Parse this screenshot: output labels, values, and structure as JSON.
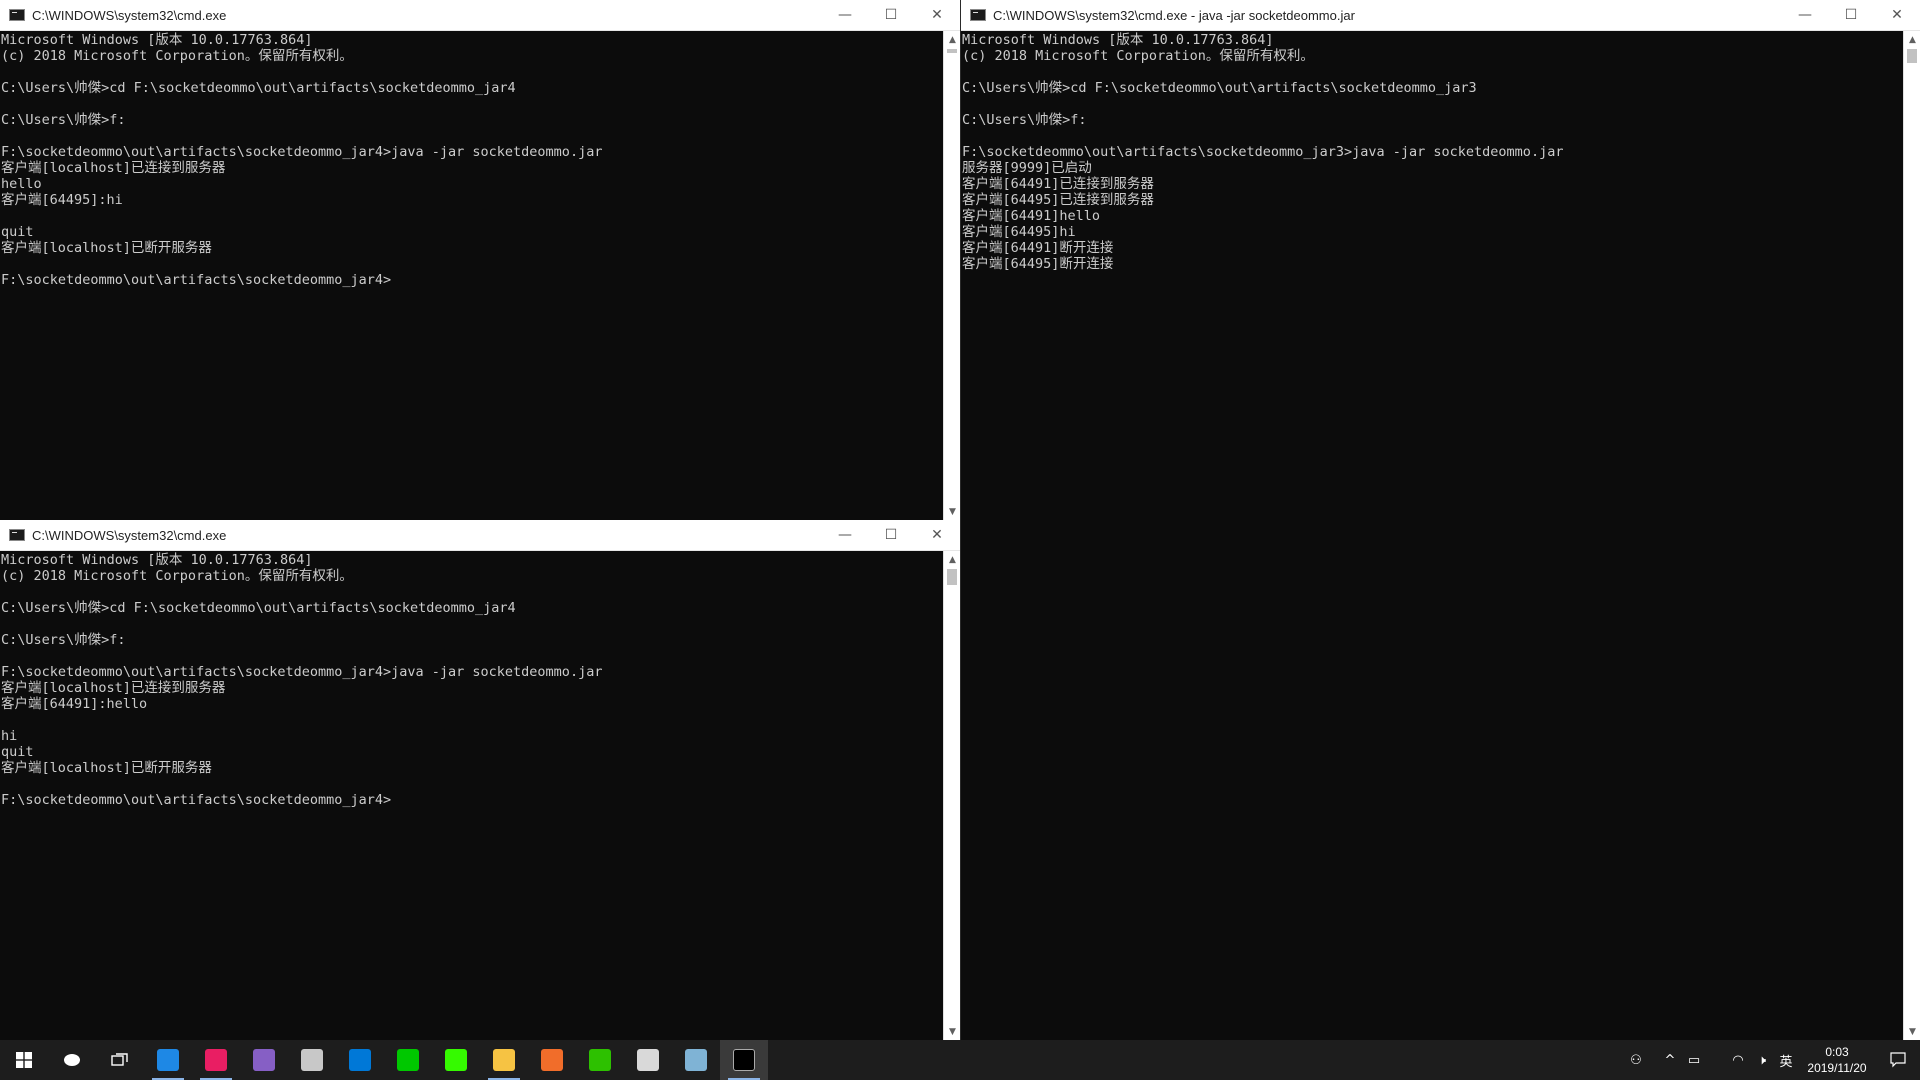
{
  "windows": {
    "top_left": {
      "title": "C:\\WINDOWS\\system32\\cmd.exe",
      "lines": [
        "Microsoft Windows [版本 10.0.17763.864]",
        "(c) 2018 Microsoft Corporation。保留所有权利。",
        "",
        "C:\\Users\\帅傑>cd F:\\socketdeommo\\out\\artifacts\\socketdeommo_jar4",
        "",
        "C:\\Users\\帅傑>f:",
        "",
        "F:\\socketdeommo\\out\\artifacts\\socketdeommo_jar4>java -jar socketdeommo.jar",
        "客户端[localhost]已连接到服务器",
        "hello",
        "客户端[64495]:hi",
        "",
        "quit",
        "客户端[localhost]已断开服务器",
        "",
        "F:\\socketdeommo\\out\\artifacts\\socketdeommo_jar4>"
      ]
    },
    "bottom_left": {
      "title": "C:\\WINDOWS\\system32\\cmd.exe",
      "lines": [
        "Microsoft Windows [版本 10.0.17763.864]",
        "(c) 2018 Microsoft Corporation。保留所有权利。",
        "",
        "C:\\Users\\帅傑>cd F:\\socketdeommo\\out\\artifacts\\socketdeommo_jar4",
        "",
        "C:\\Users\\帅傑>f:",
        "",
        "F:\\socketdeommo\\out\\artifacts\\socketdeommo_jar4>java -jar socketdeommo.jar",
        "客户端[localhost]已连接到服务器",
        "客户端[64491]:hello",
        "",
        "hi",
        "quit",
        "客户端[localhost]已断开服务器",
        "",
        "F:\\socketdeommo\\out\\artifacts\\socketdeommo_jar4>"
      ]
    },
    "right": {
      "title": "C:\\WINDOWS\\system32\\cmd.exe - java  -jar socketdeommo.jar",
      "lines": [
        "Microsoft Windows [版本 10.0.17763.864]",
        "(c) 2018 Microsoft Corporation。保留所有权利。",
        "",
        "C:\\Users\\帅傑>cd F:\\socketdeommo\\out\\artifacts\\socketdeommo_jar3",
        "",
        "C:\\Users\\帅傑>f:",
        "",
        "F:\\socketdeommo\\out\\artifacts\\socketdeommo_jar3>java -jar socketdeommo.jar",
        "服务器[9999]已启动",
        "客户端[64491]已连接到服务器",
        "客户端[64495]已连接到服务器",
        "客户端[64491]hello",
        "客户端[64495]hi",
        "客户端[64491]断开连接",
        "客户端[64495]断开连接"
      ]
    }
  },
  "window_controls": {
    "minimize": "—",
    "maximize": "☐",
    "close": "✕"
  },
  "taskbar": {
    "apps": [
      {
        "icon": "edge-icon",
        "color": "#1e88e5",
        "running": true
      },
      {
        "icon": "intellij-idea-icon",
        "color": "#e91e63",
        "running": true
      },
      {
        "icon": "visual-studio-icon",
        "color": "#865fc5",
        "running": false
      },
      {
        "icon": "tool-icon",
        "color": "#c8c8c8",
        "running": false
      },
      {
        "icon": "store-icon",
        "color": "#0078d7",
        "running": false
      },
      {
        "icon": "iqiyi-icon",
        "color": "#00c800",
        "running": false
      },
      {
        "icon": "dreamweaver-icon",
        "color": "#35fa00",
        "running": false
      },
      {
        "icon": "file-explorer-icon",
        "color": "#f6c343",
        "running": true
      },
      {
        "icon": "orange-app-icon",
        "color": "#f16d2a",
        "running": false
      },
      {
        "icon": "wechat-icon",
        "color": "#2dc100",
        "running": false
      },
      {
        "icon": "avatar-app-icon",
        "color": "#d9d9d9",
        "running": false
      },
      {
        "icon": "notepad-icon",
        "color": "#7fb3d5",
        "running": false
      },
      {
        "icon": "cmd-icon",
        "color": "#000000",
        "running": true,
        "active": true
      }
    ],
    "ime": "英",
    "clock_time": "0:03",
    "clock_date": "2019/11/20"
  }
}
